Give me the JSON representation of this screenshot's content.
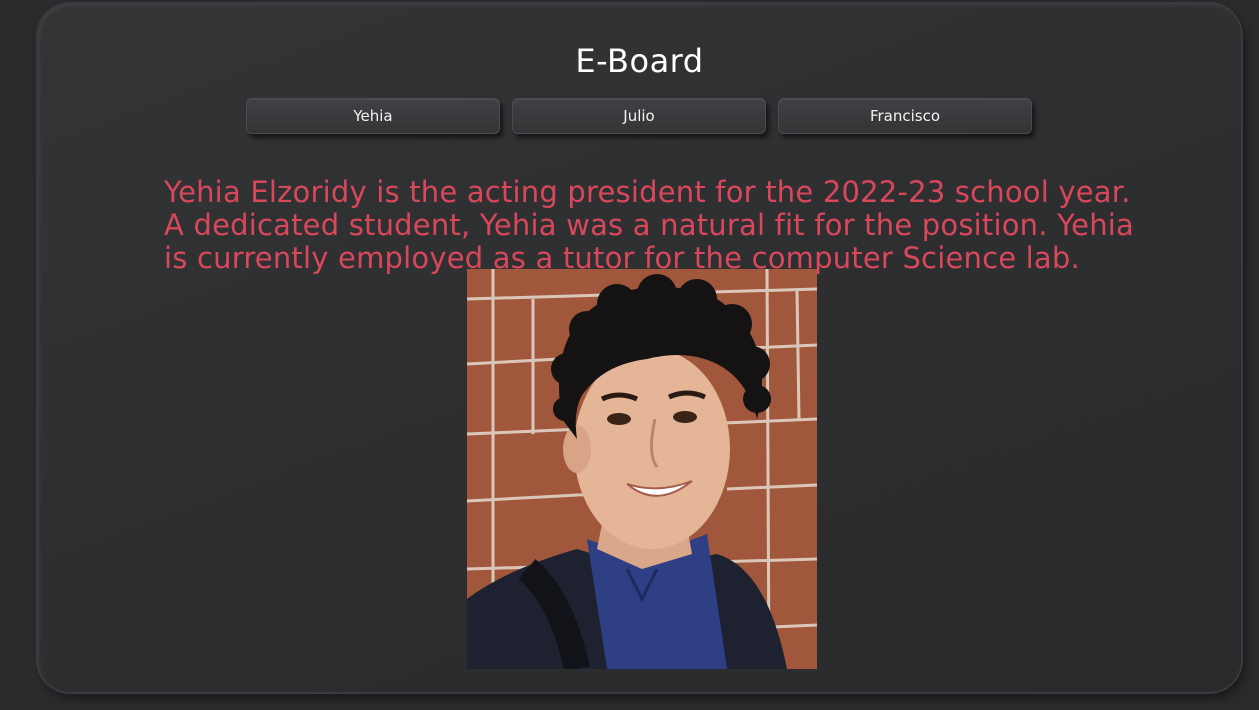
{
  "page": {
    "title": "E-Board"
  },
  "tabs": [
    {
      "label": "Yehia"
    },
    {
      "label": "Julio"
    },
    {
      "label": "Francisco"
    }
  ],
  "member": {
    "bio": "Yehia Elzoridy is the acting president for the 2022-23 school year. A dedicated student, Yehia was a natural fit for the position. Yehia is currently employed as a tutor for the computer Science lab.",
    "photo_subject": "portrait of Yehia Elzoridy"
  },
  "colors": {
    "background": "#2a2b2d",
    "card": "#313234",
    "bio_text": "#d9475a",
    "title_text": "#ffffff"
  }
}
